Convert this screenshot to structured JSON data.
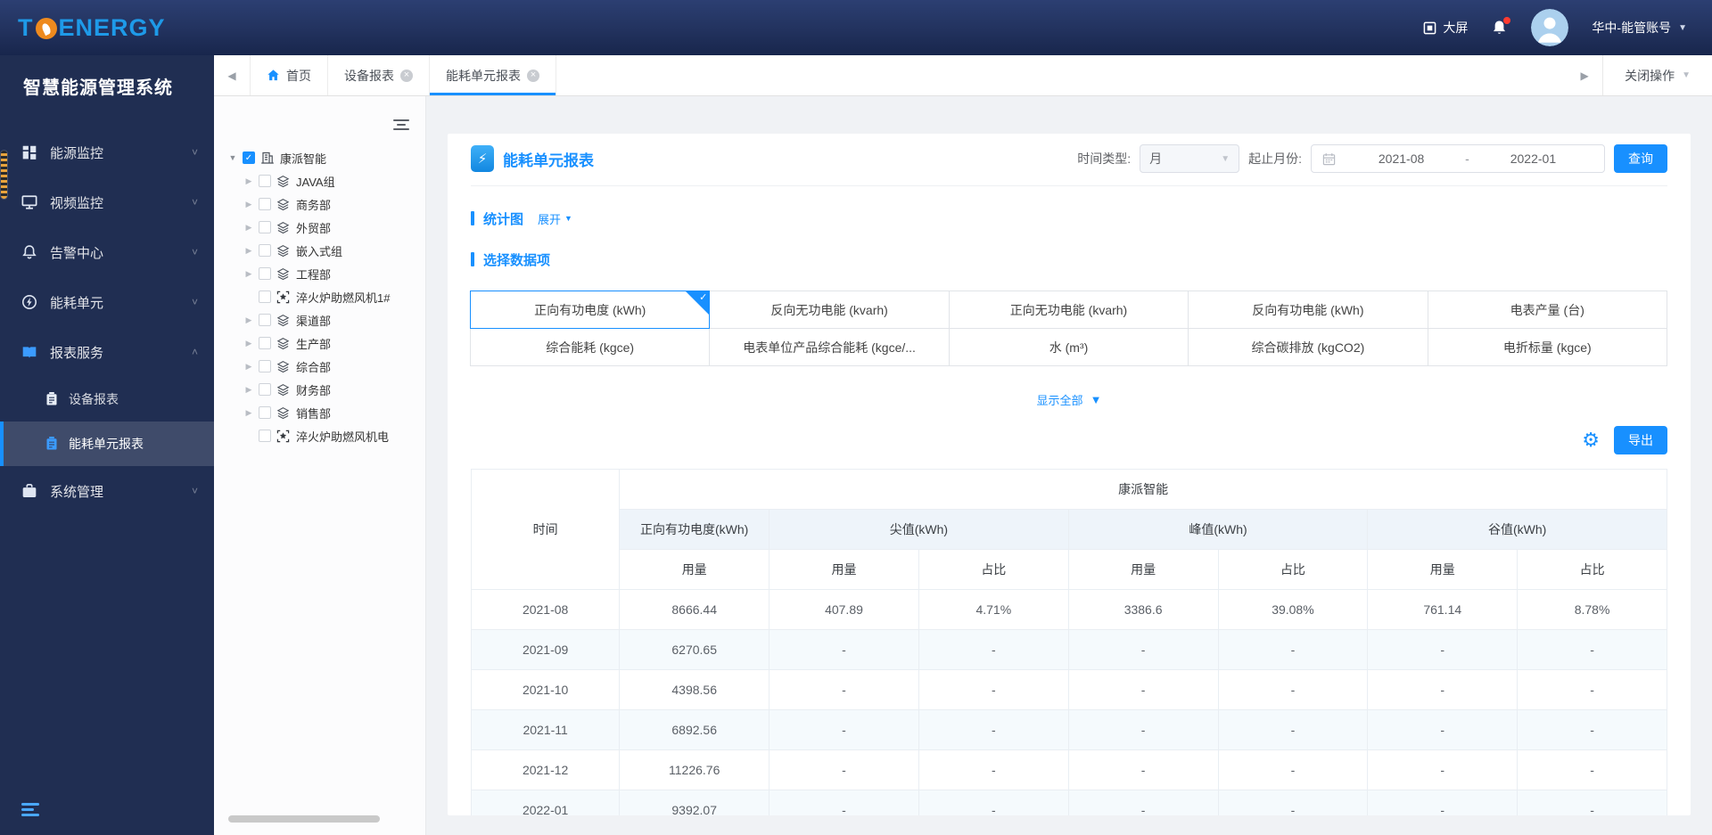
{
  "colors": {
    "accent": "#1890ff",
    "header_bg": "#22325e",
    "sidebar_bg": "#202e52",
    "logo_blue": "#1e9ae8",
    "logo_orange": "#ee8a1e",
    "notification_dot": "#ff3b30"
  },
  "header": {
    "logo_prefix": "T",
    "logo_suffix": "ENERGY",
    "big_screen_label": "大屏",
    "account": "华中-能管账号"
  },
  "tabbar": {
    "tabs": [
      {
        "label": "首页",
        "icon": "home",
        "closable": false,
        "active": false
      },
      {
        "label": "设备报表",
        "icon": "",
        "closable": true,
        "active": false
      },
      {
        "label": "能耗单元报表",
        "icon": "",
        "closable": true,
        "active": true
      }
    ],
    "close_ops_label": "关闭操作"
  },
  "sidebar": {
    "title": "智慧能源管理系统",
    "items": [
      {
        "key": "energy-monitor",
        "label": "能源监控",
        "icon": "energy-monitor-icon",
        "expanded": false
      },
      {
        "key": "video-monitor",
        "label": "视频监控",
        "icon": "video-monitor-icon",
        "expanded": false
      },
      {
        "key": "alarm-center",
        "label": "告警中心",
        "icon": "alarm-center-icon",
        "expanded": false
      },
      {
        "key": "energy-unit",
        "label": "能耗单元",
        "icon": "energy-unit-icon",
        "expanded": false
      },
      {
        "key": "report-service",
        "label": "报表服务",
        "icon": "report-service-icon",
        "expanded": true,
        "active": true,
        "children": [
          {
            "key": "device-report",
            "label": "设备报表",
            "icon": "device-report-icon",
            "active": false
          },
          {
            "key": "unit-report",
            "label": "能耗单元报表",
            "icon": "unit-report-icon",
            "active": true
          }
        ]
      },
      {
        "key": "system-manage",
        "label": "系统管理",
        "icon": "system-manage-icon",
        "expanded": false
      }
    ]
  },
  "tree": {
    "root": {
      "label": "康派智能",
      "icon": "building-icon",
      "checked": true,
      "expanded": true
    },
    "children": [
      {
        "label": "JAVA组",
        "icon": "layers-icon",
        "caret": true
      },
      {
        "label": "商务部",
        "icon": "layers-icon",
        "caret": true
      },
      {
        "label": "外贸部",
        "icon": "layers-icon",
        "caret": true
      },
      {
        "label": "嵌入式组",
        "icon": "layers-icon",
        "caret": true
      },
      {
        "label": "工程部",
        "icon": "layers-icon",
        "caret": true
      },
      {
        "label": "淬火炉助燃风机1#",
        "icon": "meter-icon",
        "caret": false
      },
      {
        "label": "渠道部",
        "icon": "layers-icon",
        "caret": true
      },
      {
        "label": "生产部",
        "icon": "layers-icon",
        "caret": true
      },
      {
        "label": "综合部",
        "icon": "layers-icon",
        "caret": true
      },
      {
        "label": "财务部",
        "icon": "layers-icon",
        "caret": true
      },
      {
        "label": "销售部",
        "icon": "layers-icon",
        "caret": true
      },
      {
        "label": "淬火炉助燃风机电",
        "icon": "meter-icon",
        "caret": false
      }
    ]
  },
  "main": {
    "title": "能耗单元报表",
    "filters": {
      "time_type_label": "时间类型:",
      "time_type_value": "月",
      "range_label": "起止月份:",
      "start": "2021-08",
      "separator": "-",
      "end": "2022-01",
      "query_label": "查询"
    },
    "sections": {
      "chart_title": "统计图",
      "expand_label": "展开",
      "select_title": "选择数据项",
      "show_all_label": "显示全部",
      "export_label": "导出"
    },
    "data_items": {
      "selected_row": 0,
      "selected_col": 0,
      "items": [
        [
          "正向有功电度 (kWh)",
          "反向无功电能 (kvarh)",
          "正向无功电能 (kvarh)",
          "反向有功电能 (kWh)",
          "电表产量 (台)"
        ],
        [
          "综合能耗 (kgce)",
          "电表单位产品综合能耗 (kgce/...",
          "水 (m³)",
          "综合碳排放 (kgCO2)",
          "电折标量 (kgce)"
        ]
      ]
    },
    "table": {
      "group_header": "康派智能",
      "time_header": "时间",
      "column_groups": [
        {
          "label": "正向有功电度(kWh)",
          "sub": [
            "用量"
          ]
        },
        {
          "label": "尖值(kWh)",
          "sub": [
            "用量",
            "占比"
          ]
        },
        {
          "label": "峰值(kWh)",
          "sub": [
            "用量",
            "占比"
          ]
        },
        {
          "label": "谷值(kWh)",
          "sub": [
            "用量",
            "占比"
          ]
        }
      ],
      "rows": [
        [
          "2021-08",
          "8666.44",
          "407.89",
          "4.71%",
          "3386.6",
          "39.08%",
          "761.14",
          "8.78%"
        ],
        [
          "2021-09",
          "6270.65",
          "-",
          "-",
          "-",
          "-",
          "-",
          "-"
        ],
        [
          "2021-10",
          "4398.56",
          "-",
          "-",
          "-",
          "-",
          "-",
          "-"
        ],
        [
          "2021-11",
          "6892.56",
          "-",
          "-",
          "-",
          "-",
          "-",
          "-"
        ],
        [
          "2021-12",
          "11226.76",
          "-",
          "-",
          "-",
          "-",
          "-",
          "-"
        ],
        [
          "2022-01",
          "9392.07",
          "-",
          "-",
          "-",
          "-",
          "-",
          "-"
        ]
      ]
    }
  }
}
